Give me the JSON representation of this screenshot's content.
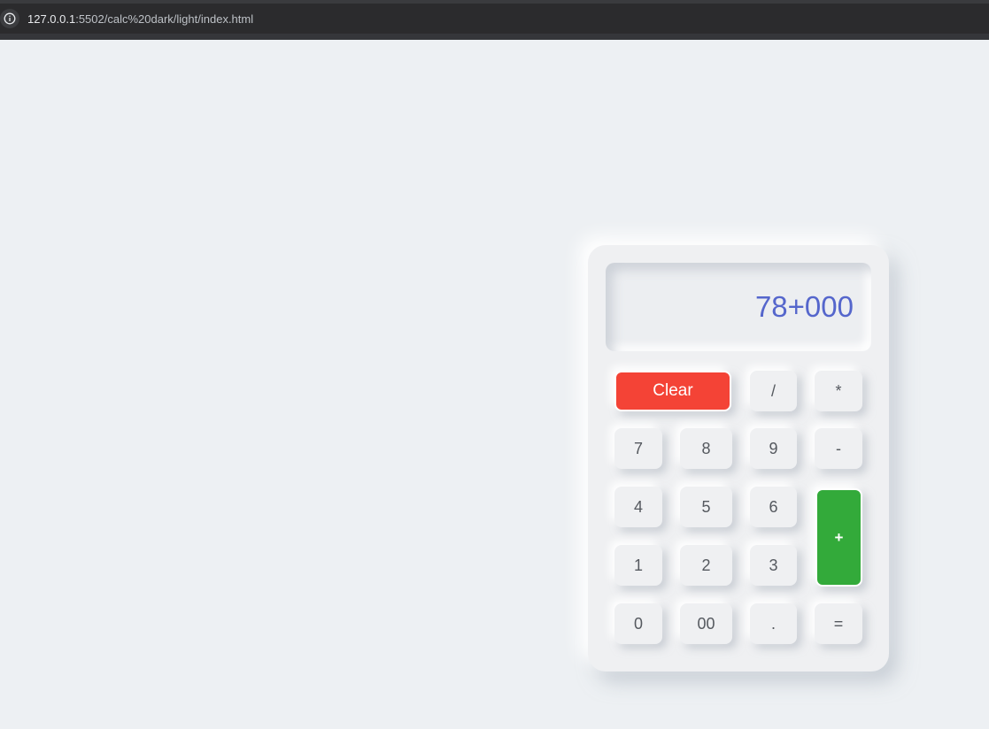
{
  "browser": {
    "url_host": "127.0.0.1",
    "url_path": ":5502/calc%20dark/light/index.html"
  },
  "calculator": {
    "display_value": "78+000",
    "buttons": {
      "clear": "Clear",
      "divide": "/",
      "multiply": "*",
      "seven": "7",
      "eight": "8",
      "nine": "9",
      "minus": "-",
      "four": "4",
      "five": "5",
      "six": "6",
      "plus": "+",
      "one": "1",
      "two": "2",
      "three": "3",
      "zero": "0",
      "double_zero": "00",
      "dot": ".",
      "equals": "="
    }
  },
  "colors": {
    "display_text": "#5566cc",
    "clear_button": "#f44336",
    "plus_button": "#33aa3a",
    "page_background": "#edf0f3"
  }
}
